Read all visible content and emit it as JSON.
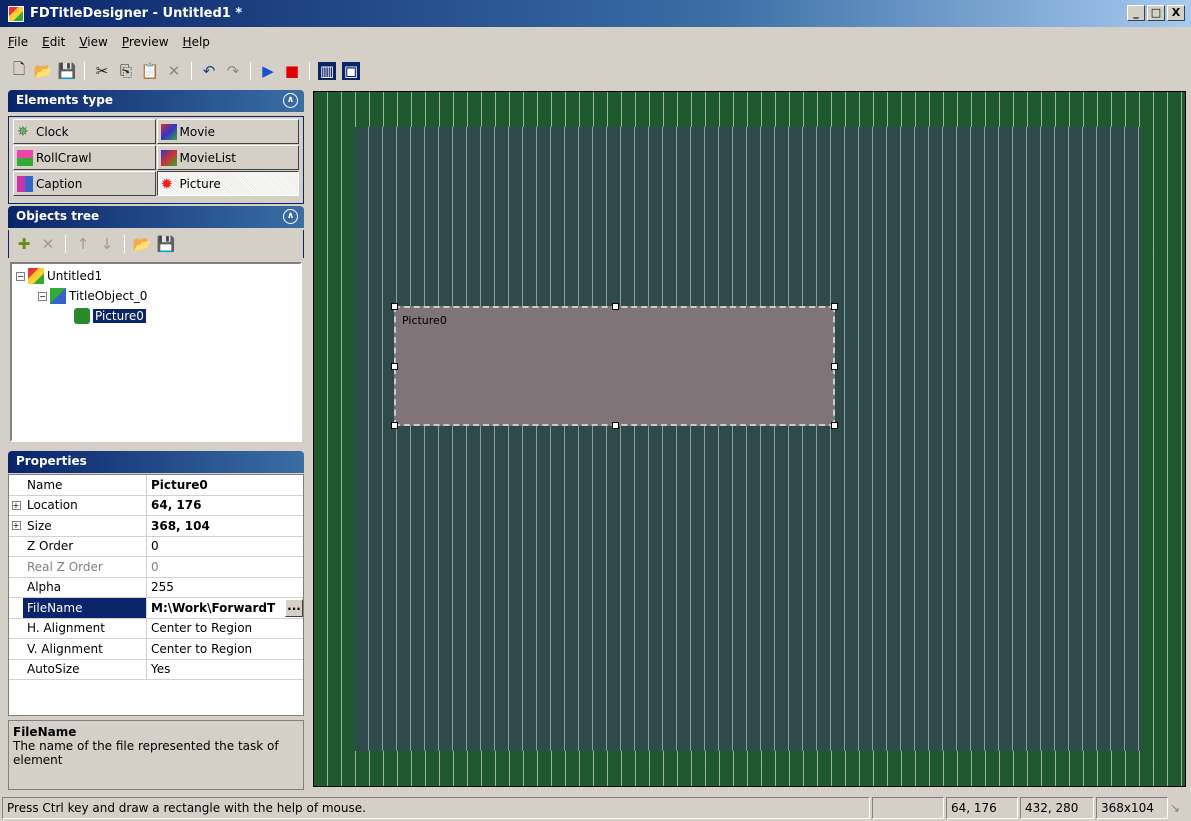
{
  "window": {
    "title": "FDTitleDesigner - Untitled1 *",
    "min": "_",
    "max": "□",
    "close": "X"
  },
  "menu": [
    "File",
    "Edit",
    "View",
    "Preview",
    "Help"
  ],
  "elements_panel": {
    "title": "Elements type",
    "items": [
      {
        "label": "Clock"
      },
      {
        "label": "Movie"
      },
      {
        "label": "RollCrawl"
      },
      {
        "label": "MovieList"
      },
      {
        "label": "Caption"
      },
      {
        "label": "Picture",
        "selected": true
      }
    ]
  },
  "objects_panel": {
    "title": "Objects tree",
    "tree": [
      {
        "label": "Untitled1",
        "expander": "−"
      },
      {
        "label": "TitleObject_0",
        "expander": "−"
      },
      {
        "label": "Picture0",
        "selected": true
      }
    ]
  },
  "properties_panel": {
    "title": "Properties",
    "rows": [
      {
        "name": "Name",
        "value": "Picture0",
        "bold": true
      },
      {
        "name": "Location",
        "value": "64, 176",
        "bold": true,
        "expander": "+"
      },
      {
        "name": "Size",
        "value": "368, 104",
        "bold": true,
        "expander": "+"
      },
      {
        "name": "Z Order",
        "value": "0"
      },
      {
        "name": "Real Z Order",
        "value": "0",
        "disabled": true
      },
      {
        "name": "Alpha",
        "value": "255"
      },
      {
        "name": "FileName",
        "value": "M:\\Work\\ForwardT",
        "bold": true,
        "selected": true,
        "button": "..."
      },
      {
        "name": "H. Alignment",
        "value": "Center to Region"
      },
      {
        "name": "V. Alignment",
        "value": "Center to Region"
      },
      {
        "name": "AutoSize",
        "value": "Yes"
      }
    ],
    "description_title": "FileName",
    "description_text": "The name of the file represented the task of element"
  },
  "canvas": {
    "object_label": "Picture0",
    "background_color": "#1f5a2e",
    "safe_area_color": "#2f4a4a",
    "object_color": "#7f7478"
  },
  "status": {
    "message": "Press Ctrl key and draw a rectangle with the help of mouse.",
    "location": "64, 176",
    "end": "432, 280",
    "size": "368x104"
  }
}
